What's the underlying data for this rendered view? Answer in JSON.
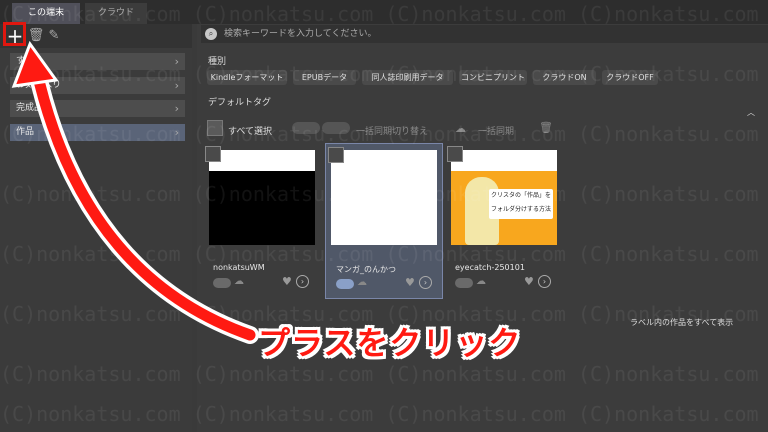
{
  "tabs": [
    {
      "label": "この端末"
    },
    {
      "label": "クラウド"
    }
  ],
  "search": {
    "placeholder": "検索キーワードを入力してください。"
  },
  "sidebar": {
    "items": [
      {
        "label": "すべて"
      },
      {
        "label": "お気に入り"
      },
      {
        "label": "完成品"
      },
      {
        "label": "作品"
      }
    ]
  },
  "filter": {
    "type_label": "種別",
    "tags": [
      "Kindleフォーマット",
      "EPUBデータ",
      "同人誌印刷用データ",
      "コンビニプリント",
      "クラウドON",
      "クラウドOFF"
    ],
    "default_tag": "デフォルトタグ"
  },
  "actions": {
    "select_all": "すべて選択",
    "sync_toggle_label": "一括同期切り替え",
    "sync_all": "一括同期"
  },
  "cards": [
    {
      "name": "nonkatsuWM"
    },
    {
      "name": "マンガ_のんかつ"
    },
    {
      "name": "eyecatch-250101"
    }
  ],
  "thumb_text": {
    "line1": "クリスタの「作品」を",
    "line2": "フォルダ分けする方法"
  },
  "show_all_link": "ラベル内の作品をすべて表示",
  "annotation": "プラスをクリック",
  "watermark": "(C)nonkatsu.com (C)nonkatsu.com (C)nonkatsu.com (C)nonkatsu.com",
  "colors": {
    "highlight": "#e0170f",
    "annotation_text": "#ff1a12",
    "selected": "#5a6478"
  }
}
